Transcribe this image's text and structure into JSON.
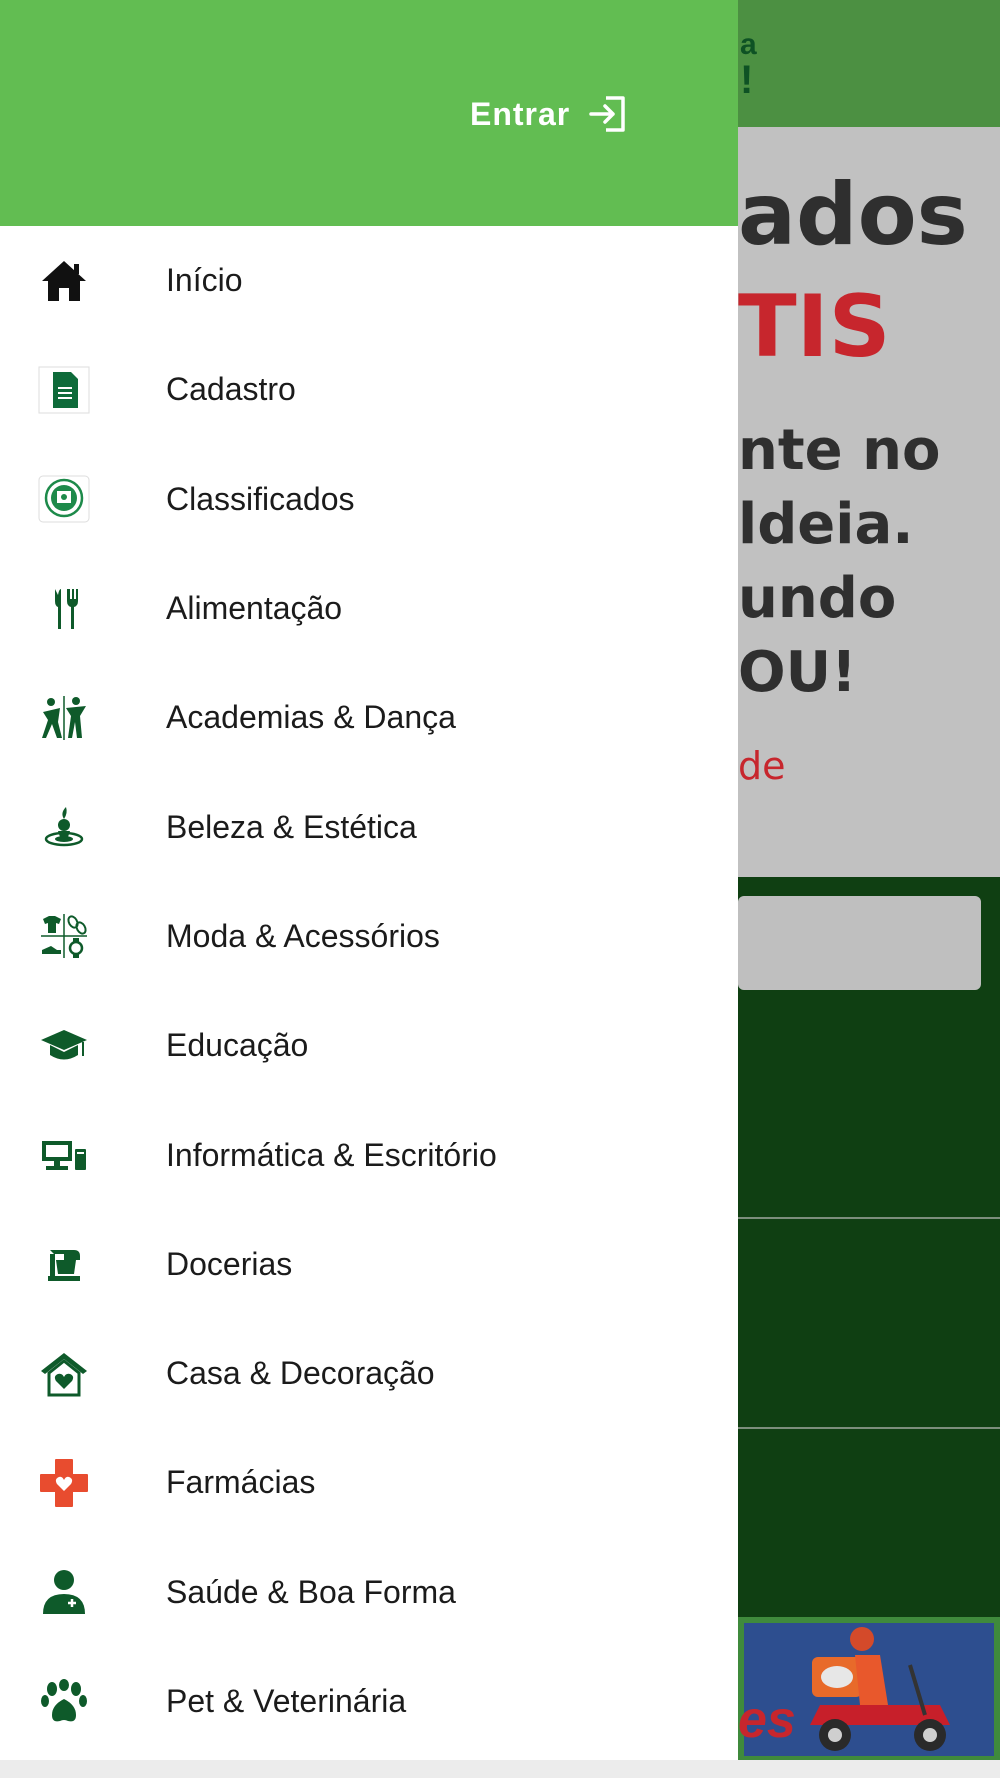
{
  "colors": {
    "drawer_header": "#62bd52",
    "icon_green": "#0e5a2a",
    "pharmacy_red": "#e84c2f",
    "background_dark_green": "#0f3f12"
  },
  "background": {
    "header_line1": "a",
    "header_line2": "!",
    "banner_lines": [
      "ados",
      "TIS",
      "nte no",
      "ldeia.",
      "undo",
      "OU!",
      "de"
    ],
    "bottom_banner_text": "es"
  },
  "drawer": {
    "login": {
      "label": "Entrar",
      "icon": "login-arrow-icon"
    },
    "items": [
      {
        "label": "Início",
        "icon": "home-icon"
      },
      {
        "label": "Cadastro",
        "icon": "form-sheet-icon"
      },
      {
        "label": "Classificados",
        "icon": "classifieds-chat-icon"
      },
      {
        "label": "Alimentação",
        "icon": "fork-knife-icon"
      },
      {
        "label": "Academias & Dança",
        "icon": "gym-dance-icon"
      },
      {
        "label": "Beleza & Estética",
        "icon": "beauty-spa-icon"
      },
      {
        "label": "Moda & Acessórios",
        "icon": "fashion-icon"
      },
      {
        "label": "Educação",
        "icon": "graduation-cap-icon"
      },
      {
        "label": "Informática & Escritório",
        "icon": "computer-icon"
      },
      {
        "label": "Docerias",
        "icon": "mixer-icon"
      },
      {
        "label": "Casa & Decoração",
        "icon": "house-heart-icon"
      },
      {
        "label": "Farmácias",
        "icon": "pharmacy-cross-icon"
      },
      {
        "label": "Saúde & Boa Forma",
        "icon": "doctor-icon"
      },
      {
        "label": "Pet & Veterinária",
        "icon": "paw-icon"
      }
    ]
  }
}
